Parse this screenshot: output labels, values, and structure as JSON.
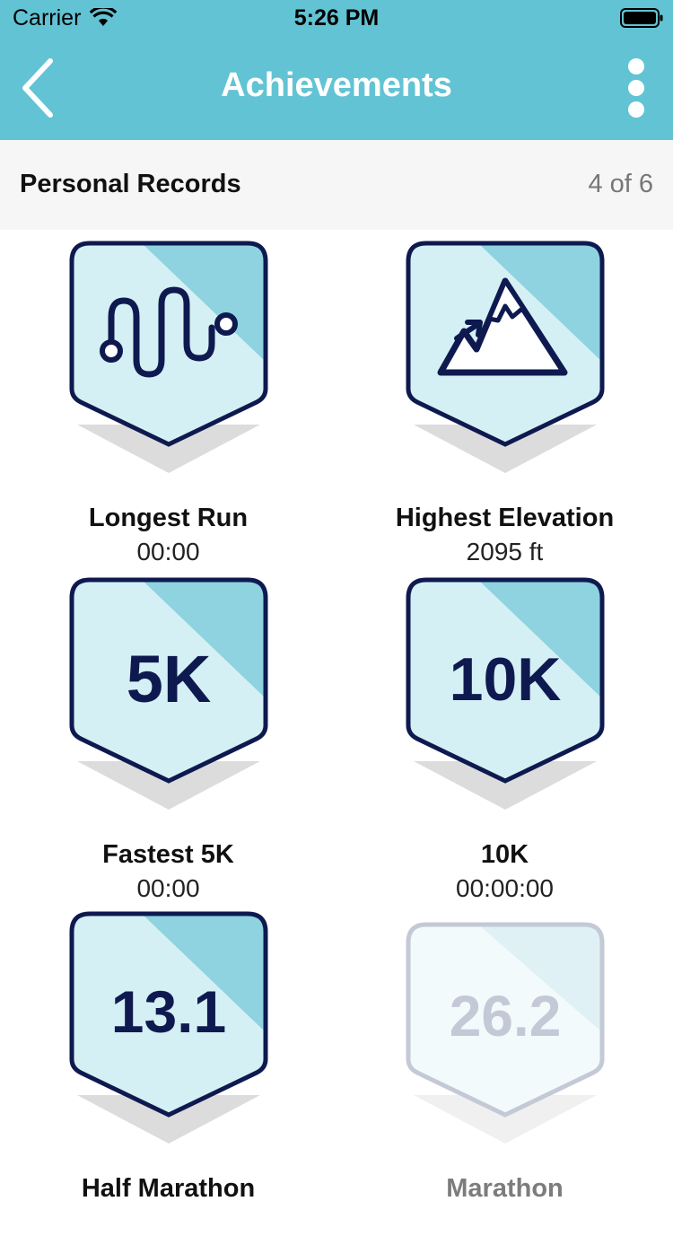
{
  "status_bar": {
    "carrier": "Carrier",
    "time": "5:26 PM"
  },
  "nav": {
    "title": "Achievements",
    "back_icon": "chevron-left-icon",
    "more_icon": "vertical-dots-icon"
  },
  "section": {
    "title": "Personal Records",
    "count": "4 of 6"
  },
  "badges": [
    {
      "name": "Longest Run",
      "value": "00:00",
      "icon": "winding-path-icon",
      "locked": false
    },
    {
      "name": "Highest Elevation",
      "value": "2095 ft",
      "icon": "mountain-icon",
      "locked": false
    },
    {
      "name": "Fastest 5K",
      "value": "00:00",
      "badge_text": "5K",
      "locked": false
    },
    {
      "name": "10K",
      "value": "00:00:00",
      "badge_text": "10K",
      "locked": false
    },
    {
      "name": "Half Marathon",
      "value": "",
      "badge_text": "13.1",
      "locked": false
    },
    {
      "name": "Marathon",
      "value": "",
      "badge_text": "26.2",
      "locked": true
    }
  ],
  "colors": {
    "header": "#62c3d4",
    "badge_outline": "#0e1a4f",
    "badge_fill": "#d5f0f5",
    "badge_stripe": "#8ed3df"
  }
}
